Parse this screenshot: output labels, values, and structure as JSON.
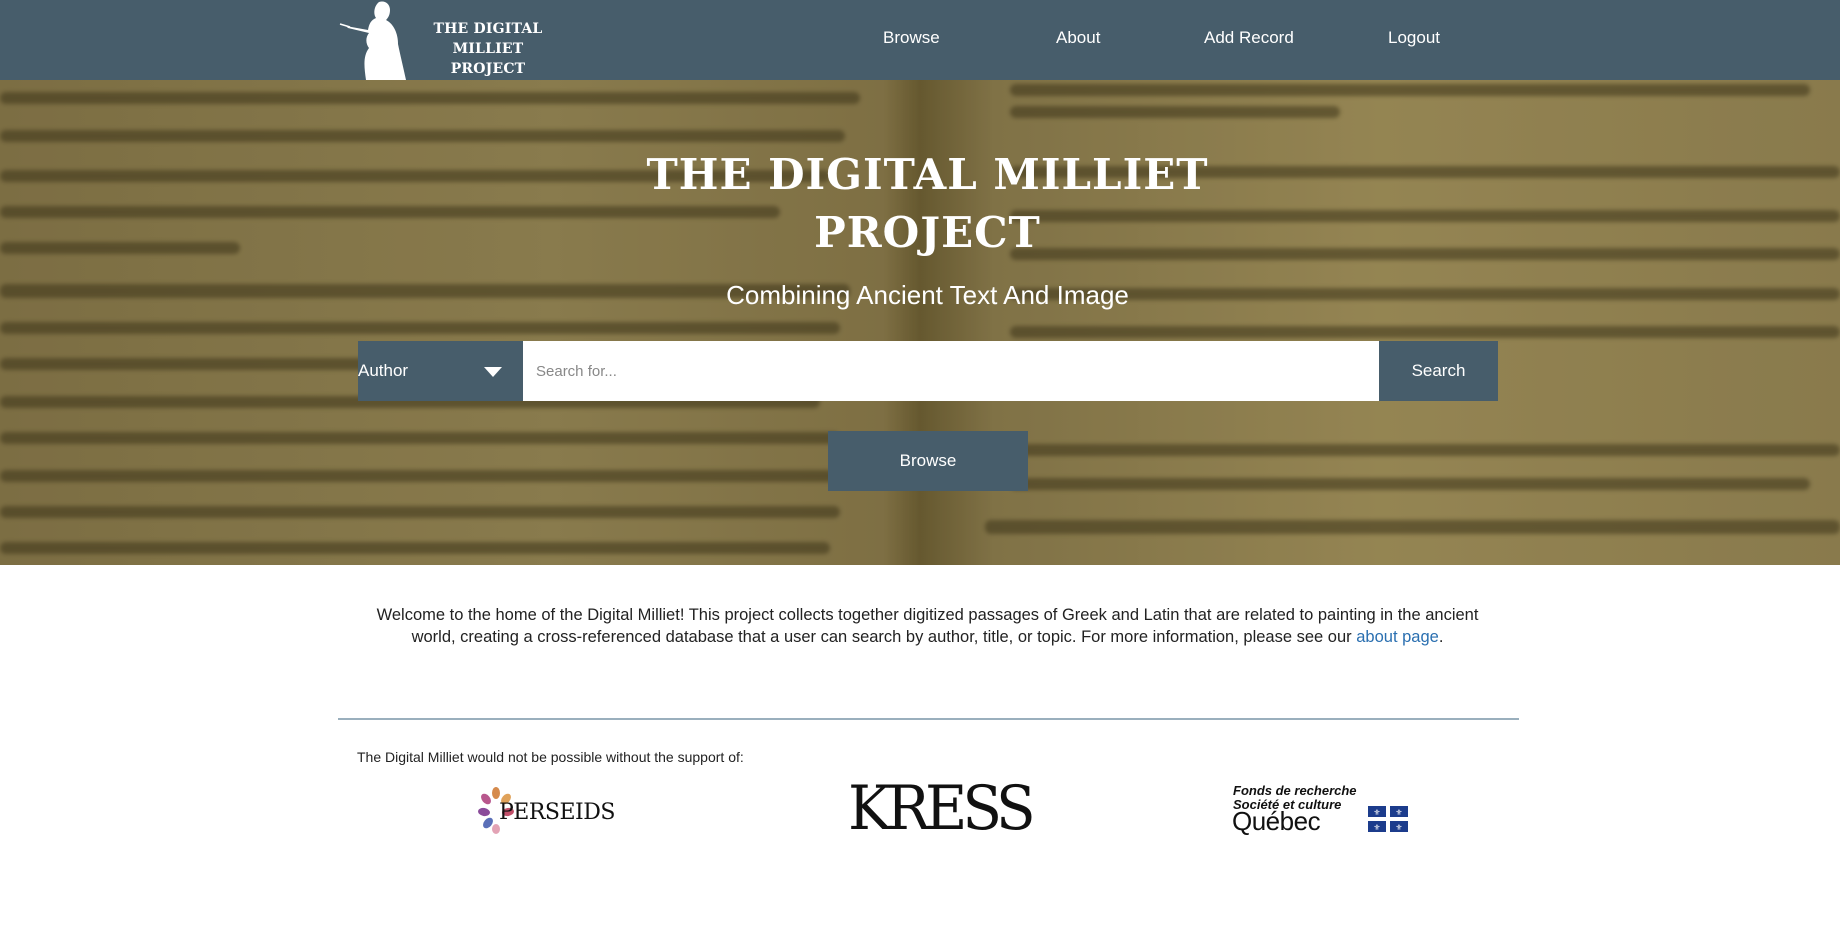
{
  "nav": {
    "logo_line1": "THE DIGITAL MILLIET",
    "logo_line2": "PROJECT",
    "items": [
      {
        "label": "Browse"
      },
      {
        "label": "About"
      },
      {
        "label": "Add Record"
      },
      {
        "label": "Logout"
      }
    ]
  },
  "hero": {
    "title_line1": "THE DIGITAL MILLIET",
    "title_line2": "PROJECT",
    "subtitle": "Combining Ancient Text And Image",
    "search": {
      "filter_selected": "Author",
      "placeholder": "Search for...",
      "value": "",
      "button_label": "Search"
    },
    "browse_button": "Browse"
  },
  "welcome": {
    "text": "Welcome to the home of the Digital Milliet! This project collects together digitized passages of Greek and Latin that are related to painting in the ancient world, creating a cross-referenced database that a user can search by author, title, or topic. For more information, please see our ",
    "link_text": "about page",
    "end": "."
  },
  "support": {
    "text": "The Digital Milliet would not be possible without the support of:",
    "sponsors": [
      {
        "name": "Perseids",
        "logo_text": "PERSEIDS"
      },
      {
        "name": "Kress",
        "logo_text": "KRESS"
      },
      {
        "name": "Fonds de recherche Société et culture Québec",
        "line1": "Fonds de recherche",
        "line2": "Société et culture",
        "line3": "Québec"
      }
    ]
  },
  "colors": {
    "nav_bg": "#475d6b",
    "button_bg": "#475d6b",
    "link": "#2a6fb0",
    "divider": "#9aafbd"
  }
}
